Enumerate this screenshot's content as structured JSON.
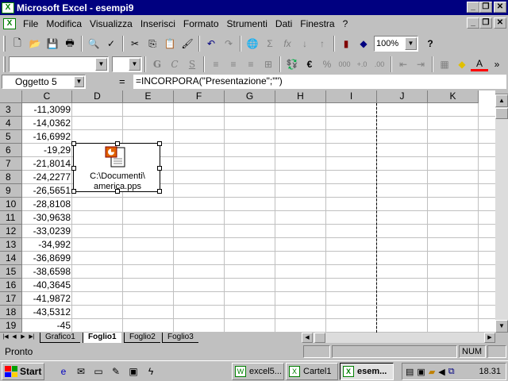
{
  "window": {
    "title": "Microsoft Excel - esempi9",
    "app_icon": "excel-icon",
    "controls": [
      "minimize",
      "restore",
      "close"
    ]
  },
  "menu": [
    "File",
    "Modifica",
    "Visualizza",
    "Inserisci",
    "Formato",
    "Strumenti",
    "Dati",
    "Finestra",
    "?"
  ],
  "toolbar1": {
    "zoom": "100%",
    "help_label": "?"
  },
  "toolbar2": {
    "font_name": "",
    "font_size": "",
    "bold": "G",
    "italic": "C",
    "underline": "S",
    "currency": "€",
    "percent": "%",
    "thousands": "000"
  },
  "formula_bar": {
    "name_box": "Oggetto 5",
    "equals": "=",
    "formula": "=INCORPORA(\"Presentazione\";\"\")"
  },
  "columns": [
    "C",
    "D",
    "E",
    "F",
    "G",
    "H",
    "I",
    "J",
    "K"
  ],
  "rows": [
    {
      "num": "3",
      "c": "-11,3099"
    },
    {
      "num": "4",
      "c": "-14,0362"
    },
    {
      "num": "5",
      "c": "-16,6992"
    },
    {
      "num": "6",
      "c": "-19,29"
    },
    {
      "num": "7",
      "c": "-21,8014"
    },
    {
      "num": "8",
      "c": "-24,2277"
    },
    {
      "num": "9",
      "c": "-26,5651"
    },
    {
      "num": "10",
      "c": "-28,8108"
    },
    {
      "num": "11",
      "c": "-30,9638"
    },
    {
      "num": "12",
      "c": "-33,0239"
    },
    {
      "num": "13",
      "c": "-34,992"
    },
    {
      "num": "14",
      "c": "-36,8699"
    },
    {
      "num": "15",
      "c": "-38,6598"
    },
    {
      "num": "16",
      "c": "-40,3645"
    },
    {
      "num": "17",
      "c": "-41,9872"
    },
    {
      "num": "18",
      "c": "-43,5312"
    },
    {
      "num": "19",
      "c": "-45"
    }
  ],
  "embedded_object": {
    "caption_line1": "C:\\Documenti\\",
    "caption_line2": "america.pps",
    "icon": "powerpoint-presentation-icon"
  },
  "sheet_tabs": [
    "Grafico1",
    "Foglio1",
    "Foglio2",
    "Foglio3"
  ],
  "active_sheet": "Foglio1",
  "status": {
    "text": "Pronto",
    "num": "NUM"
  },
  "taskbar": {
    "start": "Start",
    "buttons": [
      {
        "label": "excel5...",
        "active": false
      },
      {
        "label": "Cartel1",
        "active": false
      },
      {
        "label": "esem...",
        "active": true
      }
    ],
    "clock": "18.31"
  },
  "colors": {
    "title_bar": "#000080",
    "face": "#c0c0c0",
    "cell_bg": "#ffffff",
    "gridline": "#c0c0c0",
    "excel_green": "#008000"
  }
}
